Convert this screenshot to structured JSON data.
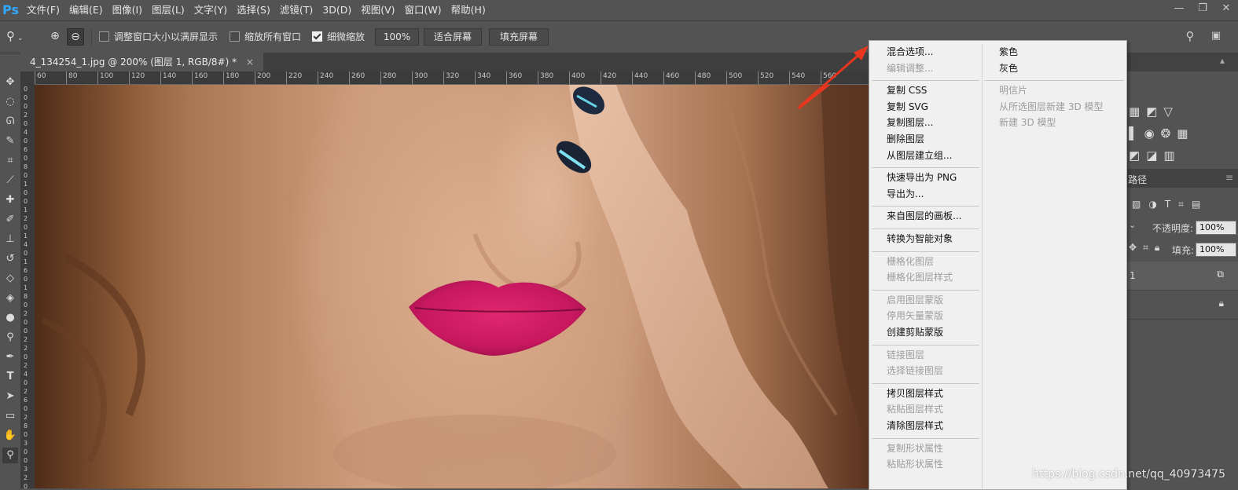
{
  "app": {
    "logo": "Ps"
  },
  "menubar": [
    "文件(F)",
    "编辑(E)",
    "图像(I)",
    "图层(L)",
    "文字(Y)",
    "选择(S)",
    "滤镜(T)",
    "3D(D)",
    "视图(V)",
    "窗口(W)",
    "帮助(H)"
  ],
  "window_controls": [
    "—",
    "❐",
    "✕"
  ],
  "options": {
    "resize_windows": "调整窗口大小以满屏显示",
    "zoom_all": "缩放所有窗口",
    "scrubby_zoom": "细微缩放",
    "scrubby_checked": true,
    "zoom_value": "100%",
    "fit_screen": "适合屏幕",
    "fill_screen": "填充屏幕"
  },
  "document_tab": {
    "title": "4_134254_1.jpg @ 200% (图层 1, RGB/8#) *",
    "close": "×"
  },
  "ruler": {
    "h_labels": [
      "60",
      "80",
      "100",
      "120",
      "140",
      "160",
      "180",
      "200",
      "220",
      "240",
      "260",
      "280",
      "300",
      "320",
      "340",
      "360",
      "380",
      "400",
      "420",
      "440",
      "460",
      "480",
      "500",
      "520",
      "540",
      "560"
    ],
    "v_labels": [
      "0",
      "0",
      "0",
      "2",
      "0",
      "4",
      "0",
      "6",
      "0",
      "8",
      "0",
      "1",
      "0",
      "0",
      "1",
      "2",
      "0",
      "1",
      "4",
      "0",
      "1",
      "6",
      "0",
      "1",
      "8",
      "0",
      "2",
      "0",
      "0",
      "2",
      "2",
      "0",
      "2",
      "4",
      "0",
      "2",
      "6",
      "0",
      "2",
      "8",
      "0",
      "3",
      "0",
      "0",
      "3",
      "2",
      "0"
    ]
  },
  "right_panel": {
    "paths_tab": "路径",
    "opacity_label": "不透明度:",
    "opacity_value": "100%",
    "fill_label": "填充:",
    "fill_value": "100%",
    "layer_name": "1"
  },
  "context_menu": {
    "left": [
      {
        "label": "混合选项...",
        "disabled": false
      },
      {
        "label": "编辑调整...",
        "disabled": true
      },
      {
        "sep": true
      },
      {
        "label": "复制 CSS",
        "disabled": false
      },
      {
        "label": "复制 SVG",
        "disabled": false
      },
      {
        "label": "复制图层...",
        "disabled": false
      },
      {
        "label": "删除图层",
        "disabled": false
      },
      {
        "label": "从图层建立组...",
        "disabled": false
      },
      {
        "sep": true
      },
      {
        "label": "快速导出为 PNG",
        "disabled": false
      },
      {
        "label": "导出为...",
        "disabled": false
      },
      {
        "sep": true
      },
      {
        "label": "来自图层的画板...",
        "disabled": false
      },
      {
        "sep": true
      },
      {
        "label": "转换为智能对象",
        "disabled": false
      },
      {
        "sep": true
      },
      {
        "label": "栅格化图层",
        "disabled": true
      },
      {
        "label": "栅格化图层样式",
        "disabled": true
      },
      {
        "sep": true
      },
      {
        "label": "启用图层蒙版",
        "disabled": true
      },
      {
        "label": "停用矢量蒙版",
        "disabled": true
      },
      {
        "label": "创建剪贴蒙版",
        "disabled": false
      },
      {
        "sep": true
      },
      {
        "label": "链接图层",
        "disabled": true
      },
      {
        "label": "选择链接图层",
        "disabled": true
      },
      {
        "sep": true
      },
      {
        "label": "拷贝图层样式",
        "disabled": false
      },
      {
        "label": "粘贴图层样式",
        "disabled": true
      },
      {
        "label": "清除图层样式",
        "disabled": false
      },
      {
        "sep": true
      },
      {
        "label": "复制形状属性",
        "disabled": true
      },
      {
        "label": "粘贴形状属性",
        "disabled": true
      }
    ],
    "right": [
      {
        "label": "紫色",
        "disabled": false
      },
      {
        "label": "灰色",
        "disabled": false
      },
      {
        "sep": true
      },
      {
        "label": "明信片",
        "disabled": true
      },
      {
        "label": "从所选图层新建 3D 模型",
        "disabled": true
      },
      {
        "label": "新建 3D 模型",
        "disabled": true
      }
    ]
  },
  "watermark": "https://blog.csdn.net/qq_40973475",
  "colors": {
    "accent": "#31a8ff",
    "menu_bg": "#f0f0f0",
    "arrow": "#e8351e",
    "lips": "#d61f6d"
  }
}
